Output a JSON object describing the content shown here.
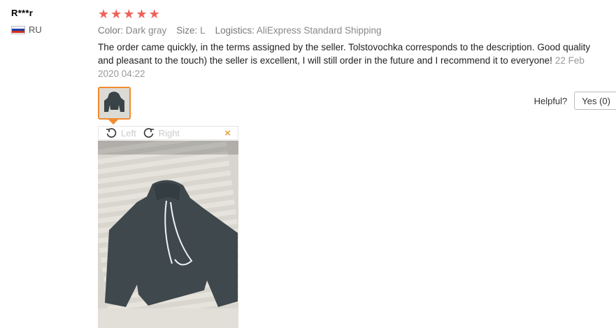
{
  "user": {
    "name": "R***r",
    "country": "RU"
  },
  "review": {
    "rating": 5,
    "attributes": [
      {
        "key": "Color:",
        "value": "Dark gray"
      },
      {
        "key": "Size:",
        "value": "L"
      },
      {
        "key": "Logistics:",
        "value": "AliExpress Standard Shipping"
      }
    ],
    "text": "The order came quickly, in the terms assigned by the seller. Tolstovochka corresponds to the description. Good quality and pleasant to the touch) the seller is excellent, I will still order in the future and I recommend it to everyone!",
    "date": "22 Feb 2020 04:22"
  },
  "helpful": {
    "label": "Helpful?",
    "yes": "Yes (0)"
  },
  "viewer": {
    "rotate_left": "Left",
    "rotate_right": "Right",
    "close": "×"
  },
  "colors": {
    "star": "#f06059",
    "thumb_border": "#f08c2e",
    "close": "#e8a33d"
  }
}
